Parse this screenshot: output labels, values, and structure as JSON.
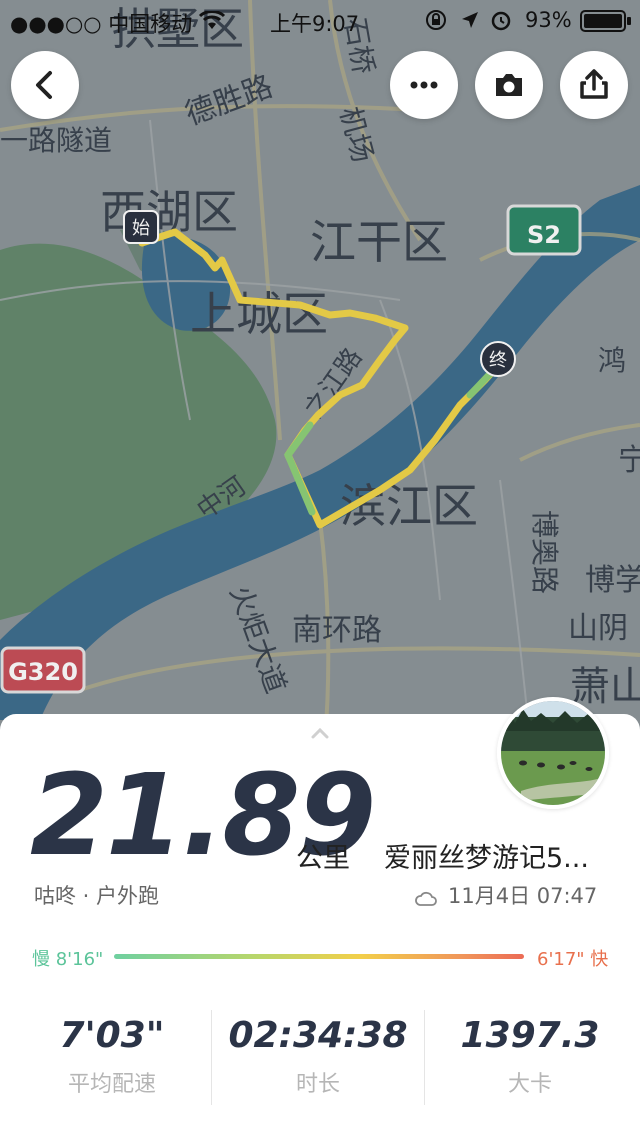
{
  "status_bar": {
    "carrier": "●●●○○ 中国移动",
    "time": "上午9:07",
    "battery": "93%"
  },
  "map": {
    "labels": {
      "gongshu": "拱墅区",
      "desheng": "德胜路",
      "tunnel": "一路隧道",
      "xihu": "西湖区",
      "jianggan": "江干区",
      "shangcheng": "上城区",
      "binjiang": "滨江区",
      "s2": "S2",
      "g320": "G320",
      "nanhuan": "南环路",
      "huoju": "火炬大道",
      "bo": "博奥路",
      "boxue": "博学",
      "shanyin": "山阴",
      "xiao": "萧山",
      "hong": "鸿",
      "ning": "宁",
      "zhong": "中河",
      "shi": "石桥",
      "ji": "机场",
      "riverside": "之江路"
    },
    "start_marker": "始",
    "end_marker": "终"
  },
  "toolbar": {
    "back_icon": "chevron-left-icon",
    "more_icon": "more-dots-icon",
    "camera_icon": "camera-icon",
    "share_icon": "share-icon"
  },
  "run": {
    "distance": "21.89",
    "unit": "公里",
    "title": "爱丽丝梦游记5...",
    "source": "咕咚 · 户外跑",
    "datetime": "11月4日 07:47",
    "pace_slow": "慢 8'16\"",
    "pace_fast": "6'17\" 快"
  },
  "stats": [
    {
      "value": "7'03\"",
      "label": "平均配速"
    },
    {
      "value": "02:34:38",
      "label": "时长"
    },
    {
      "value": "1397.3",
      "label": "大卡"
    }
  ],
  "colors": {
    "route_yellow": "#f2d64b",
    "route_green": "#8fd17a",
    "river": "#3f6f8f",
    "accent_dark": "#2b3447"
  }
}
